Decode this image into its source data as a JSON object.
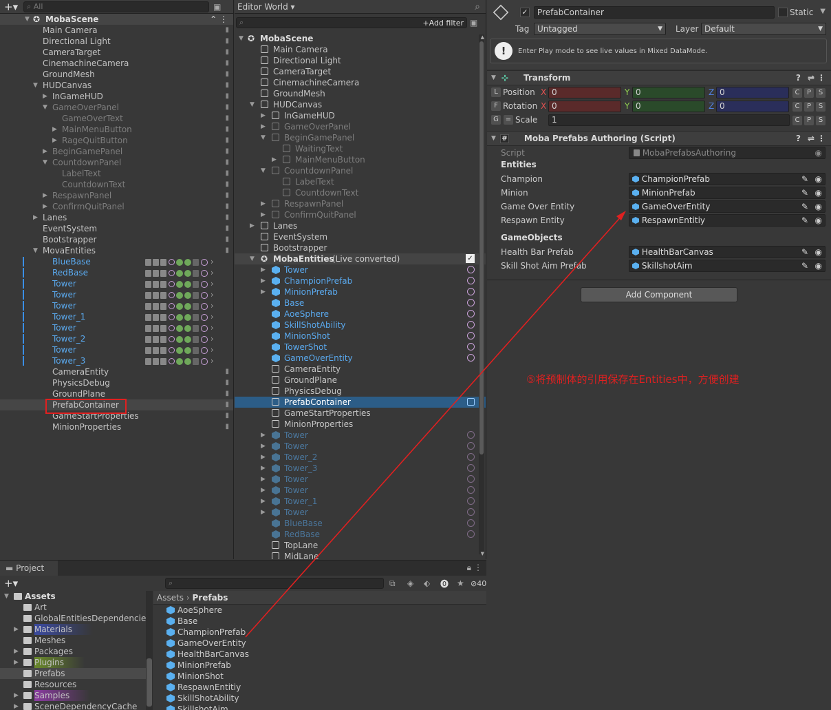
{
  "hierarchy_left": {
    "search_placeholder": "All",
    "scene": "MobaScene",
    "items": [
      {
        "t": "Main Camera",
        "d": 1,
        "s": "n"
      },
      {
        "t": "Directional Light",
        "d": 1,
        "s": "n"
      },
      {
        "t": "CameraTarget",
        "d": 1,
        "s": "n"
      },
      {
        "t": "CinemachineCamera",
        "d": 1,
        "s": "n"
      },
      {
        "t": "GroundMesh",
        "d": 1,
        "s": "n"
      },
      {
        "t": "HUDCanvas",
        "d": 1,
        "s": "n",
        "a": "open"
      },
      {
        "t": "InGameHUD",
        "d": 2,
        "s": "n",
        "a": "closed"
      },
      {
        "t": "GameOverPanel",
        "d": 2,
        "s": "dim",
        "a": "open"
      },
      {
        "t": "GameOverText",
        "d": 3,
        "s": "dim"
      },
      {
        "t": "MainMenuButton",
        "d": 3,
        "s": "dim",
        "a": "closed"
      },
      {
        "t": "RageQuitButton",
        "d": 3,
        "s": "dim",
        "a": "closed"
      },
      {
        "t": "BeginGamePanel",
        "d": 2,
        "s": "dim",
        "a": "closed"
      },
      {
        "t": "CountdownPanel",
        "d": 2,
        "s": "dim",
        "a": "open"
      },
      {
        "t": "LabelText",
        "d": 3,
        "s": "dim"
      },
      {
        "t": "CountdownText",
        "d": 3,
        "s": "dim"
      },
      {
        "t": "RespawnPanel",
        "d": 2,
        "s": "dim",
        "a": "closed"
      },
      {
        "t": "ConfirmQuitPanel",
        "d": 2,
        "s": "dim",
        "a": "closed"
      },
      {
        "t": "Lanes",
        "d": 1,
        "s": "n",
        "a": "closed"
      },
      {
        "t": "EventSystem",
        "d": 1,
        "s": "n"
      },
      {
        "t": "Bootstrapper",
        "d": 1,
        "s": "n"
      },
      {
        "t": "MovaEntities",
        "d": 1,
        "s": "n",
        "a": "open"
      },
      {
        "t": "BlueBase",
        "d": 2,
        "s": "blue"
      },
      {
        "t": "RedBase",
        "d": 2,
        "s": "blue"
      },
      {
        "t": "Tower",
        "d": 2,
        "s": "blue"
      },
      {
        "t": "Tower",
        "d": 2,
        "s": "blue"
      },
      {
        "t": "Tower",
        "d": 2,
        "s": "blue"
      },
      {
        "t": "Tower_1",
        "d": 2,
        "s": "blue"
      },
      {
        "t": "Tower",
        "d": 2,
        "s": "blue"
      },
      {
        "t": "Tower_2",
        "d": 2,
        "s": "blue"
      },
      {
        "t": "Tower",
        "d": 2,
        "s": "blue"
      },
      {
        "t": "Tower_3",
        "d": 2,
        "s": "blue"
      },
      {
        "t": "CameraEntity",
        "d": 2,
        "s": "n"
      },
      {
        "t": "PhysicsDebug",
        "d": 2,
        "s": "n"
      },
      {
        "t": "GroundPlane",
        "d": 2,
        "s": "n"
      },
      {
        "t": "PrefabContainer",
        "d": 2,
        "s": "n"
      },
      {
        "t": "GameStartProperties",
        "d": 2,
        "s": "n"
      },
      {
        "t": "MinionProperties",
        "d": 2,
        "s": "n"
      }
    ]
  },
  "editor_world": {
    "title": "Editor World",
    "add_filter": "+Add filter",
    "scene": "MobaScene",
    "live_converted": "(Live converted)",
    "items": [
      {
        "t": "Main Camera",
        "d": 1,
        "s": "n"
      },
      {
        "t": "Directional Light",
        "d": 1,
        "s": "n"
      },
      {
        "t": "CameraTarget",
        "d": 1,
        "s": "n"
      },
      {
        "t": "CinemachineCamera",
        "d": 1,
        "s": "n"
      },
      {
        "t": "GroundMesh",
        "d": 1,
        "s": "n"
      },
      {
        "t": "HUDCanvas",
        "d": 1,
        "s": "n",
        "a": "open"
      },
      {
        "t": "InGameHUD",
        "d": 2,
        "s": "n",
        "a": "closed"
      },
      {
        "t": "GameOverPanel",
        "d": 2,
        "s": "dim",
        "a": "closed"
      },
      {
        "t": "BeginGamePanel",
        "d": 2,
        "s": "dim",
        "a": "open"
      },
      {
        "t": "WaitingText",
        "d": 3,
        "s": "dim"
      },
      {
        "t": "MainMenuButton",
        "d": 3,
        "s": "dim",
        "a": "closed"
      },
      {
        "t": "CountdownPanel",
        "d": 2,
        "s": "dim",
        "a": "open"
      },
      {
        "t": "LabelText",
        "d": 3,
        "s": "dim"
      },
      {
        "t": "CountdownText",
        "d": 3,
        "s": "dim"
      },
      {
        "t": "RespawnPanel",
        "d": 2,
        "s": "dim",
        "a": "closed"
      },
      {
        "t": "ConfirmQuitPanel",
        "d": 2,
        "s": "dim",
        "a": "closed"
      },
      {
        "t": "Lanes",
        "d": 1,
        "s": "n",
        "a": "closed"
      },
      {
        "t": "EventSystem",
        "d": 1,
        "s": "n"
      },
      {
        "t": "Bootstrapper",
        "d": 1,
        "s": "n"
      },
      {
        "t": "MobaEntities",
        "d": 1,
        "s": "bold",
        "a": "open"
      },
      {
        "t": "Tower",
        "d": 2,
        "s": "blue",
        "a": "closed",
        "e": 1
      },
      {
        "t": "ChampionPrefab",
        "d": 2,
        "s": "blue",
        "a": "closed",
        "e": 1
      },
      {
        "t": "MinionPrefab",
        "d": 2,
        "s": "blue",
        "a": "closed",
        "e": 1
      },
      {
        "t": "Base",
        "d": 2,
        "s": "blue",
        "e": 1
      },
      {
        "t": "AoeSphere",
        "d": 2,
        "s": "blue",
        "e": 1
      },
      {
        "t": "SkillShotAbility",
        "d": 2,
        "s": "blue",
        "e": 1
      },
      {
        "t": "MinionShot",
        "d": 2,
        "s": "blue",
        "e": 1
      },
      {
        "t": "TowerShot",
        "d": 2,
        "s": "blue",
        "e": 1
      },
      {
        "t": "GameOverEntity",
        "d": 2,
        "s": "blue",
        "e": 1
      },
      {
        "t": "CameraEntity",
        "d": 2,
        "s": "n"
      },
      {
        "t": "GroundPlane",
        "d": 2,
        "s": "n"
      },
      {
        "t": "PhysicsDebug",
        "d": 2,
        "s": "n"
      },
      {
        "t": "PrefabContainer",
        "d": 2,
        "s": "sel"
      },
      {
        "t": "GameStartProperties",
        "d": 2,
        "s": "n"
      },
      {
        "t": "MinionProperties",
        "d": 2,
        "s": "n"
      },
      {
        "t": "Tower",
        "d": 2,
        "s": "dimb",
        "a": "closed",
        "e": 1
      },
      {
        "t": "Tower",
        "d": 2,
        "s": "dimb",
        "a": "closed",
        "e": 1
      },
      {
        "t": "Tower_2",
        "d": 2,
        "s": "dimb",
        "a": "closed",
        "e": 1
      },
      {
        "t": "Tower_3",
        "d": 2,
        "s": "dimb",
        "a": "closed",
        "e": 1
      },
      {
        "t": "Tower",
        "d": 2,
        "s": "dimb",
        "a": "closed",
        "e": 1
      },
      {
        "t": "Tower",
        "d": 2,
        "s": "dimb",
        "a": "closed",
        "e": 1
      },
      {
        "t": "Tower_1",
        "d": 2,
        "s": "dimb",
        "a": "closed",
        "e": 1
      },
      {
        "t": "Tower",
        "d": 2,
        "s": "dimb",
        "a": "closed",
        "e": 1
      },
      {
        "t": "BlueBase",
        "d": 2,
        "s": "dimb",
        "e": 1
      },
      {
        "t": "RedBase",
        "d": 2,
        "s": "dimb",
        "e": 1
      },
      {
        "t": "TopLane",
        "d": 2,
        "s": "n"
      },
      {
        "t": "MidLane",
        "d": 2,
        "s": "n"
      }
    ]
  },
  "inspector": {
    "object_name": "PrefabContainer",
    "static_label": "Static",
    "tag_label": "Tag",
    "tag_value": "Untagged",
    "layer_label": "Layer",
    "layer_value": "Default",
    "info": "Enter Play mode to see live values in Mixed DataMode.",
    "transform": {
      "title": "Transform",
      "position_label": "Position",
      "rotation_label": "Rotation",
      "scale_label": "Scale",
      "pos": [
        "0",
        "0",
        "0"
      ],
      "rot": [
        "0",
        "0",
        "0"
      ],
      "scale": "1",
      "L": "L",
      "F": "F",
      "G": "G",
      "X": "X",
      "Y": "Y",
      "Z": "Z",
      "C": "C",
      "P": "P",
      "S": "S"
    },
    "script_comp": {
      "title": "Moba Prefabs Authoring (Script)",
      "script_label": "Script",
      "script_value": "MobaPrefabsAuthoring",
      "entities_header": "Entities",
      "gameobjects_header": "GameObjects",
      "fields": [
        {
          "label": "Champion",
          "value": "ChampionPrefab"
        },
        {
          "label": "Minion",
          "value": "MinionPrefab"
        },
        {
          "label": "Game Over Entity",
          "value": "GameOverEntity"
        },
        {
          "label": "Respawn Entity",
          "value": "RespawnEntitiy"
        }
      ],
      "go_fields": [
        {
          "label": "Health Bar Prefab",
          "value": "HealthBarCanvas"
        },
        {
          "label": "Skill Shot Aim Prefab",
          "value": "SkillshotAim"
        }
      ]
    },
    "add_component": "Add Component"
  },
  "annotation": "⑤将预制体的引用保存在Entities中，方便创建",
  "project": {
    "tab": "Project",
    "hidden_count": "40",
    "breadcrumb_root": "Assets",
    "breadcrumb_current": "Prefabs",
    "folders": [
      {
        "t": "Assets",
        "d": 0,
        "bold": true
      },
      {
        "t": "Art",
        "d": 1
      },
      {
        "t": "GlobalEntitiesDependencies",
        "d": 1
      },
      {
        "t": "Materials",
        "d": 1,
        "hl": "#3a4aa0"
      },
      {
        "t": "Meshes",
        "d": 1
      },
      {
        "t": "Packages",
        "d": 1
      },
      {
        "t": "Plugins",
        "d": 1,
        "hl": "#6a8a2a"
      },
      {
        "t": "Prefabs",
        "d": 1,
        "sel": true
      },
      {
        "t": "Resources",
        "d": 1
      },
      {
        "t": "Samples",
        "d": 1,
        "hl": "#8a3aa0"
      },
      {
        "t": "SceneDependencyCache",
        "d": 1
      }
    ],
    "files": [
      "AoeSphere",
      "Base",
      "ChampionPrefab",
      "GameOverEntity",
      "HealthBarCanvas",
      "MinionPrefab",
      "MinionShot",
      "RespawnEntitiy",
      "SkillShotAbility",
      "SkillshotAim"
    ]
  },
  "colors": {
    "accent": "#2c5d87",
    "entity_blue": "#5aa9ee",
    "annotation": "#e02020"
  }
}
